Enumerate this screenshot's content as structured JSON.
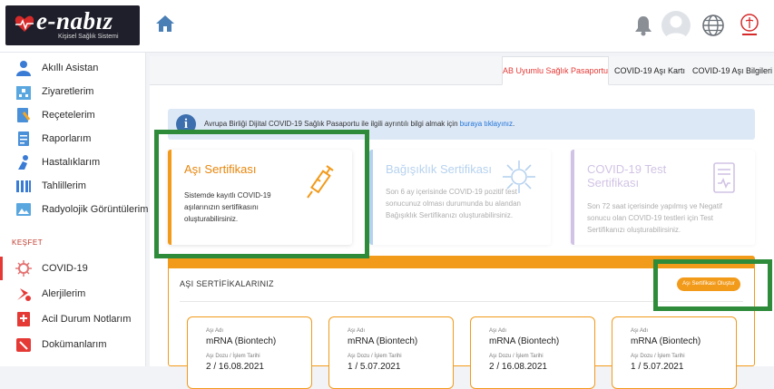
{
  "header": {
    "logo_text": "e-nabız",
    "logo_subtitle": "Kişisel Sağlık Sistemi",
    "home_icon": "home-icon",
    "bell_icon": "bell-icon",
    "globe_icon": "globe-icon"
  },
  "sidebar": {
    "items": [
      {
        "label": "Akıllı Asistan",
        "icon": "assistant-icon"
      },
      {
        "label": "Ziyaretlerim",
        "icon": "hospital-icon"
      },
      {
        "label": "Reçetelerim",
        "icon": "prescription-icon"
      },
      {
        "label": "Raporlarım",
        "icon": "report-icon"
      },
      {
        "label": "Hastalıklarım",
        "icon": "disease-icon"
      },
      {
        "label": "Tahlillerim",
        "icon": "test-icon"
      },
      {
        "label": "Radyolojik Görüntülerim",
        "icon": "radiology-icon"
      }
    ],
    "section_label": "KEŞFET",
    "explore_items": [
      {
        "label": "COVID-19",
        "icon": "virus-icon"
      },
      {
        "label": "Alerjilerim",
        "icon": "allergy-icon"
      },
      {
        "label": "Acil Durum Notlarım",
        "icon": "emergency-notes-icon"
      },
      {
        "label": "Dokümanlarım",
        "icon": "document-icon"
      }
    ]
  },
  "tabs": [
    {
      "label": "AB Uyumlu Sağlık Pasaportu"
    },
    {
      "label": "COVID-19 Aşı Kartı"
    },
    {
      "label": "COVID-19 Aşı Bilgileri"
    }
  ],
  "info": {
    "text": "Avrupa Birliği Dijital COVID-19 Sağlık Pasaportu ile ilgili ayrıntılı bilgi almak için ",
    "link": "buraya tıklayınız",
    "suffix": "."
  },
  "certificates": [
    {
      "title": "Aşı Sertifikası",
      "desc": "Sistemde kayıtlı COVID-19 aşılarınızın sertifikasını oluşturabilirsiniz.",
      "icon": "syringe-icon",
      "color": "#f29a1a"
    },
    {
      "title": "Bağışıklık Sertifikası",
      "desc": "Son 6 ay içerisinde COVID-19 pozitif test sonucunuz olması durumunda bu alandan Bağışıklık Sertifikanızı oluşturabilirsiniz.",
      "icon": "antibody-icon",
      "color": "#4a90d9"
    },
    {
      "title": "COVID-19 Test Sertifikası",
      "desc": "Son 72 saat içerisinde yapılmış ve Negatif sonucu olan COVID-19 testleri için Test Sertifikanızı oluşturabilirsiniz.",
      "icon": "test-certificate-icon",
      "color": "#8e6bbf"
    }
  ],
  "vaccine_section": {
    "title": "AŞI SERTİFİKALARINIZ",
    "create_button": "Aşı Sertifikası Oluştur",
    "cards": [
      {
        "name_label": "Aşı Adı",
        "name": "mRNA (Biontech)",
        "dose_label": "Aşı Dozu / İşlem Tarihi",
        "dose": "2 / 16.08.2021"
      },
      {
        "name_label": "Aşı Adı",
        "name": "mRNA (Biontech)",
        "dose_label": "Aşı Dozu / İşlem Tarihi",
        "dose": "1 / 5.07.2021"
      },
      {
        "name_label": "Aşı Adı",
        "name": "mRNA (Biontech)",
        "dose_label": "Aşı Dozu / İşlem Tarihi",
        "dose": "2 / 16.08.2021"
      },
      {
        "name_label": "Aşı Adı",
        "name": "mRNA (Biontech)",
        "dose_label": "Aşı Dozu / İşlem Tarihi",
        "dose": "1 / 5.07.2021"
      }
    ]
  },
  "colors": {
    "accent_orange": "#f29a1a",
    "highlight_green": "#2e8b3a",
    "active_red": "#e53935"
  }
}
